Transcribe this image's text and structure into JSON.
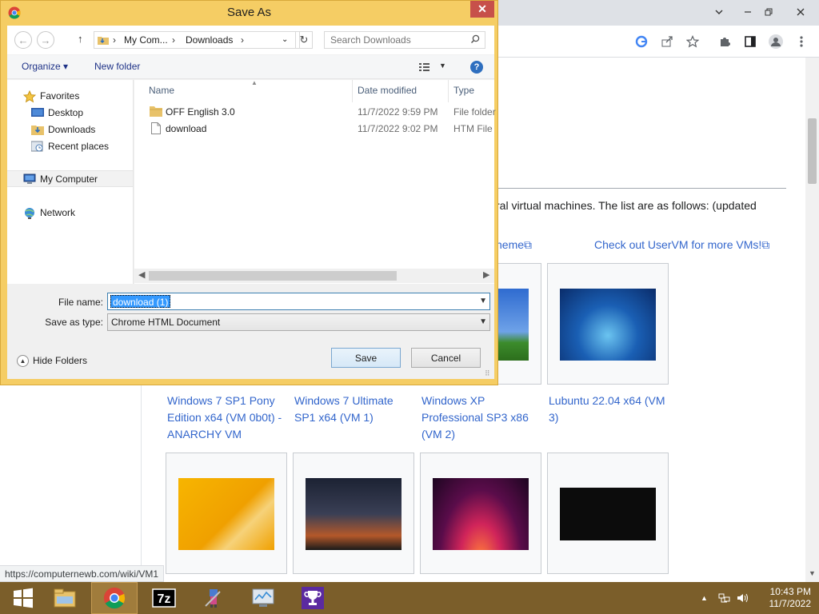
{
  "dialog": {
    "title": "Save As",
    "close_glyph": "✕",
    "address": {
      "crumb1": "My Com...",
      "crumb2": "Downloads",
      "sep": "›"
    },
    "search_placeholder": "Search Downloads",
    "commands": {
      "organize": "Organize ▾",
      "new_folder": "New folder",
      "help": "?"
    },
    "nav": {
      "favorites": "Favorites",
      "desktop": "Desktop",
      "downloads": "Downloads",
      "recent": "Recent places",
      "computer": "My Computer",
      "network": "Network"
    },
    "columns": {
      "name": "Name",
      "date": "Date modified",
      "type": "Type"
    },
    "files": [
      {
        "name": "OFF English 3.0",
        "date": "11/7/2022 9:59 PM",
        "type": "File folder"
      },
      {
        "name": "download",
        "date": "11/7/2022 9:02 PM",
        "type": "HTM File"
      }
    ],
    "file_name_label": "File name:",
    "file_name_value": "download (1)",
    "save_type_label": "Save as type:",
    "save_type_value": "Chrome HTML Document",
    "hide_folders": "Hide Folders",
    "save_button": "Save",
    "cancel_button": "Cancel"
  },
  "page": {
    "intro_text": "ral virtual machines. The list are as follows: (updated",
    "link_theme": "heme",
    "link_uservm": "Check out UserVM for more VMs!",
    "captions": [
      "Windows 7 SP1 Pony Edition x64 (VM 0b0t) - ANARCHY VM",
      "Windows 7 Ultimate SP1 x64 (VM 1)",
      "Windows XP Professional SP3 x86 (VM 2)",
      "Lubuntu 22.04 x64 (VM 3)"
    ],
    "status_url": "https://computernewb.com/wiki/VM1"
  },
  "taskbar": {
    "time": "10:43 PM",
    "date": "11/7/2022"
  },
  "colors": {
    "dialog_frame": "#f5cd64",
    "taskbar": "#7b5e2a",
    "link": "#3366cc",
    "selection": "#3399ff"
  }
}
